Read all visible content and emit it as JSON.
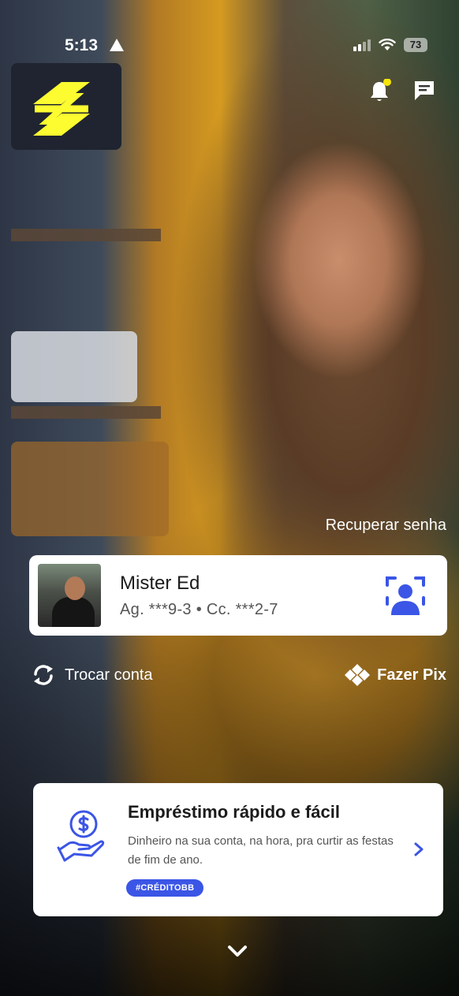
{
  "status_bar": {
    "time": "5:13",
    "battery": "73"
  },
  "header": {
    "logo": "bb-logo",
    "notifications_icon": "bell-icon",
    "messages_icon": "chat-icon"
  },
  "login": {
    "recover_password_label": "Recuperar senha",
    "account": {
      "name": "Mister Ed",
      "details": "Ag. ***9-3 • Cc. ***2-7",
      "auth_icon": "face-id-icon"
    },
    "switch_account_label": "Trocar conta",
    "pix_label": "Fazer Pix"
  },
  "promo": {
    "title": "Empréstimo rápido e fácil",
    "text": "Dinheiro na sua conta, na hora, pra curtir as festas de fim de ano.",
    "tag": "#CRÉDITOBB",
    "icon": "money-hand-icon"
  },
  "colors": {
    "brand_yellow": "#fcfc30",
    "accent_blue": "#3b55e6",
    "notification_dot": "#f6e40a"
  }
}
